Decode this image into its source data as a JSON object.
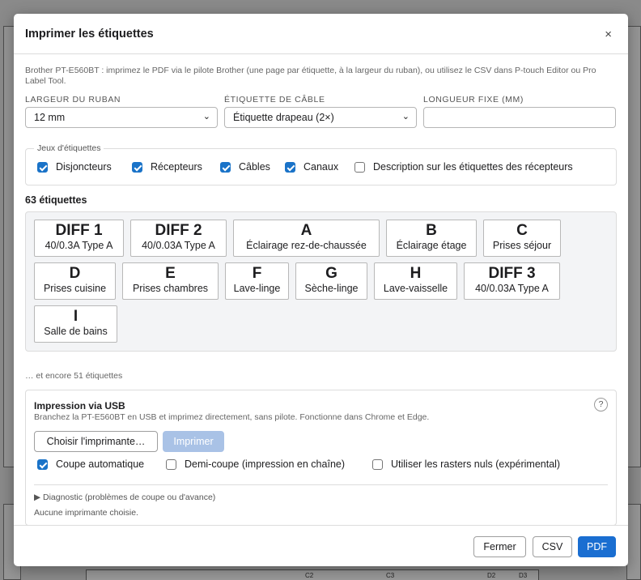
{
  "dialog": {
    "title": "Imprimer les étiquettes",
    "close_glyph": "×",
    "intro": "Brother PT-E560BT : imprimez le PDF via le pilote Brother (une page par étiquette, à la largeur du ruban), ou utilisez le CSV dans P-touch Editor ou Pro Label Tool."
  },
  "settings": {
    "ribbon_width_label": "LARGEUR DU RUBAN",
    "ribbon_width_value": "12 mm",
    "cable_label_label": "ÉTIQUETTE DE CÂBLE",
    "cable_label_value": "Étiquette drapeau (2×)",
    "fixed_length_label": "LONGUEUR FIXE (MM)",
    "fixed_length_value": ""
  },
  "label_sets": {
    "legend": "Jeux d'étiquettes",
    "options": [
      {
        "label": "Disjoncteurs",
        "checked": true
      },
      {
        "label": "Récepteurs",
        "checked": true
      },
      {
        "label": "Câbles",
        "checked": true
      },
      {
        "label": "Canaux",
        "checked": true
      },
      {
        "label": "Description sur les étiquettes des récepteurs",
        "checked": false
      }
    ]
  },
  "labels": {
    "count_text": "63 étiquettes",
    "items": [
      {
        "code": "DIFF 1",
        "desc": "40/0.3A Type A"
      },
      {
        "code": "DIFF 2",
        "desc": "40/0.03A Type A"
      },
      {
        "code": "A",
        "desc": "Éclairage rez-de-chaussée"
      },
      {
        "code": "B",
        "desc": "Éclairage étage"
      },
      {
        "code": "C",
        "desc": "Prises séjour"
      },
      {
        "code": "D",
        "desc": "Prises cuisine"
      },
      {
        "code": "E",
        "desc": "Prises chambres"
      },
      {
        "code": "F",
        "desc": "Lave-linge"
      },
      {
        "code": "G",
        "desc": "Sèche-linge"
      },
      {
        "code": "H",
        "desc": "Lave-vaisselle"
      },
      {
        "code": "DIFF 3",
        "desc": "40/0.03A Type A"
      },
      {
        "code": "I",
        "desc": "Salle de bains"
      }
    ],
    "more_text": "… et encore 51 étiquettes"
  },
  "usb": {
    "title": "Impression via USB",
    "description": "Branchez la PT-E560BT en USB et imprimez directement, sans pilote. Fonctionne dans Chrome et Edge.",
    "help_glyph": "?",
    "choose_printer_label": "Choisir l'imprimante…",
    "print_label": "Imprimer",
    "options": [
      {
        "label": "Coupe automatique",
        "checked": true
      },
      {
        "label": "Demi-coupe (impression en chaîne)",
        "checked": false
      },
      {
        "label": "Utiliser les rasters nuls (expérimental)",
        "checked": false
      }
    ],
    "diagnostic_label": "▶ Diagnostic (problèmes de coupe ou d'avance)",
    "status": "Aucune imprimante choisie."
  },
  "footer": {
    "close_label": "Fermer",
    "csv_label": "CSV",
    "pdf_label": "PDF"
  },
  "background": {
    "cells": [
      "C2",
      "C3",
      "D2",
      "D3"
    ]
  },
  "colors": {
    "accent": "#1a6ed1",
    "checkbox": "#1a73c8",
    "disabled_button": "#a9c2e6"
  }
}
